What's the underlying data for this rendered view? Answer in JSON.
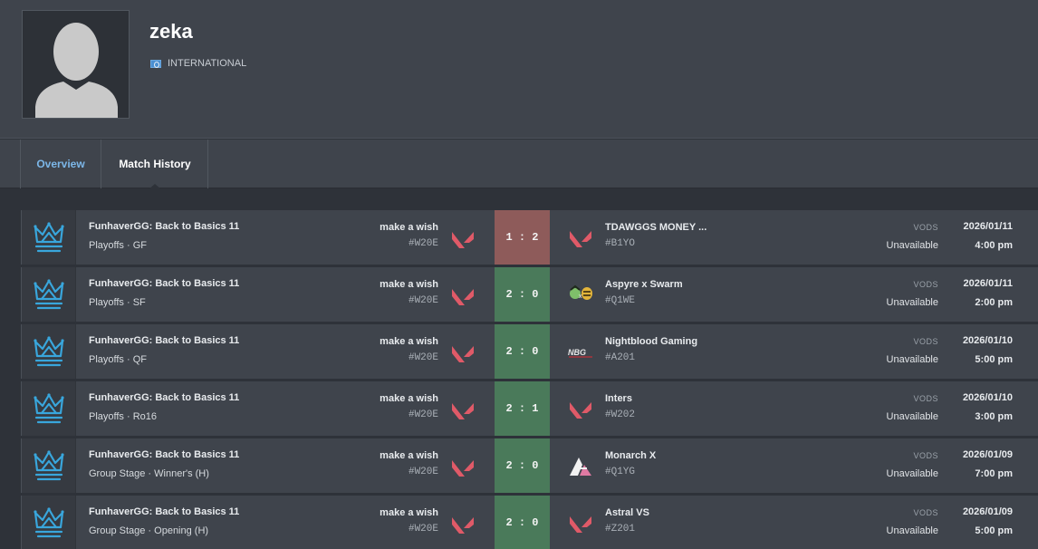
{
  "profile": {
    "name": "zeka",
    "country": "INTERNATIONAL",
    "avatar_icon": "default-avatar-silhouette",
    "flag_icon": "un-flag-icon"
  },
  "tabs": [
    {
      "label": "Overview",
      "active": false
    },
    {
      "label": "Match History",
      "active": true
    }
  ],
  "colors": {
    "win": "#4a7a5a",
    "loss": "#8e5b5a",
    "valorant": "#e05a68",
    "league": "#39a6dc",
    "active_tab_link": "#7cb7e8"
  },
  "vods_label": "VODS",
  "matches": [
    {
      "event": "FunhaverGG: Back to Basics 11",
      "stage": "Playoffs · GF",
      "team1": "make a wish",
      "team1_tag": "#W20E",
      "score": "1 : 2",
      "result": "loss",
      "team2": "TDAWGGS MONEY ...",
      "team2_tag": "#B1YO",
      "team2_logo": "valorant-icon",
      "vods": "Unavailable",
      "date": "2026/01/11",
      "time": "4:00 pm"
    },
    {
      "event": "FunhaverGG: Back to Basics 11",
      "stage": "Playoffs · SF",
      "team1": "make a wish",
      "team1_tag": "#W20E",
      "score": "2 : 0",
      "result": "win",
      "team2": "Aspyre x Swarm",
      "team2_tag": "#Q1WE",
      "team2_logo": "aspyre-swarm-logo",
      "vods": "Unavailable",
      "date": "2026/01/11",
      "time": "2:00 pm"
    },
    {
      "event": "FunhaverGG: Back to Basics 11",
      "stage": "Playoffs · QF",
      "team1": "make a wish",
      "team1_tag": "#W20E",
      "score": "2 : 0",
      "result": "win",
      "team2": "Nightblood Gaming",
      "team2_tag": "#A201",
      "team2_logo": "nightblood-logo",
      "vods": "Unavailable",
      "date": "2026/01/10",
      "time": "5:00 pm"
    },
    {
      "event": "FunhaverGG: Back to Basics 11",
      "stage": "Playoffs · Ro16",
      "team1": "make a wish",
      "team1_tag": "#W20E",
      "score": "2 : 1",
      "result": "win",
      "team2": "Inters",
      "team2_tag": "#W202",
      "team2_logo": "valorant-icon",
      "vods": "Unavailable",
      "date": "2026/01/10",
      "time": "3:00 pm"
    },
    {
      "event": "FunhaverGG: Back to Basics 11",
      "stage": "Group Stage · Winner's (H)",
      "team1": "make a wish",
      "team1_tag": "#W20E",
      "score": "2 : 0",
      "result": "win",
      "team2": "Monarch X",
      "team2_tag": "#Q1YG",
      "team2_logo": "monarch-logo",
      "vods": "Unavailable",
      "date": "2026/01/09",
      "time": "7:00 pm"
    },
    {
      "event": "FunhaverGG: Back to Basics 11",
      "stage": "Group Stage · Opening (H)",
      "team1": "make a wish",
      "team1_tag": "#W20E",
      "score": "2 : 0",
      "result": "win",
      "team2": "Astral VS",
      "team2_tag": "#Z201",
      "team2_logo": "valorant-icon",
      "vods": "Unavailable",
      "date": "2026/01/09",
      "time": "5:00 pm"
    }
  ]
}
